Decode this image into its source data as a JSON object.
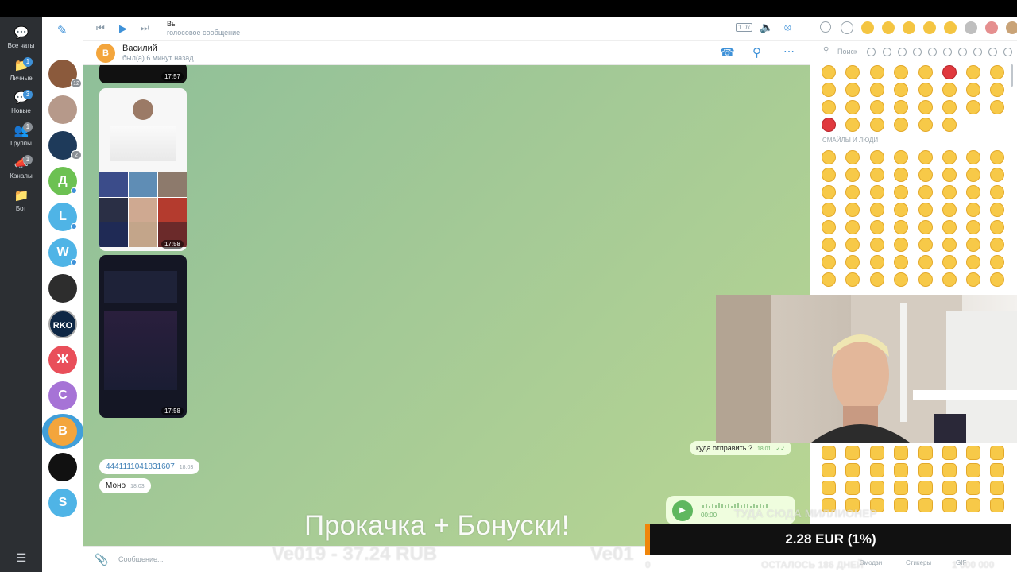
{
  "nav": {
    "items": [
      {
        "label": "Все чаты",
        "badge": "",
        "icon": "chat-icon"
      },
      {
        "label": "Личные",
        "badge": "1",
        "icon": "folder-icon"
      },
      {
        "label": "Новые",
        "badge": "3",
        "icon": "chat-icon"
      },
      {
        "label": "Группы",
        "badge": "1",
        "icon": "group-icon"
      },
      {
        "label": "Каналы",
        "badge": "1",
        "icon": "megaphone-icon"
      },
      {
        "label": "Бот",
        "badge": "",
        "icon": "folder-icon"
      }
    ]
  },
  "chatlist": {
    "avatars": [
      {
        "letter": "",
        "color": "#8b5a3c",
        "badge": "12",
        "online": false
      },
      {
        "letter": "",
        "color": "#b6998a",
        "badge": "",
        "online": false
      },
      {
        "letter": "",
        "color": "#1e3a5a",
        "badge": "2",
        "online": false
      },
      {
        "letter": "Д",
        "color": "#6cc152",
        "badge": "",
        "online": true
      },
      {
        "letter": "L",
        "color": "#4fb4e6",
        "badge": "",
        "online": true
      },
      {
        "letter": "W",
        "color": "#4fb4e6",
        "badge": "",
        "online": true
      },
      {
        "letter": "",
        "color": "#2d2d2d",
        "badge": "",
        "online": false
      },
      {
        "letter": "RKO",
        "color": "#0e2745",
        "badge": "",
        "online": false
      },
      {
        "letter": "Ж",
        "color": "#e94f5a",
        "badge": "",
        "online": false
      },
      {
        "letter": "С",
        "color": "#a673d6",
        "badge": "",
        "online": false
      },
      {
        "letter": "В",
        "color": "#f3a53c",
        "badge": "",
        "online": false
      },
      {
        "letter": "",
        "color": "#111111",
        "badge": "",
        "online": false
      },
      {
        "letter": "S",
        "color": "#4fb4e6",
        "badge": "",
        "online": false
      }
    ]
  },
  "player": {
    "name": "Вы",
    "subtitle": "голосовое сообщение",
    "speed": "1.0x"
  },
  "chat": {
    "name": "Василий",
    "status": "был(а) 6 минут назад",
    "avatar_letter": "В",
    "screenshot_times": [
      "17:57",
      "17:58",
      "17:58"
    ],
    "messages_in": [
      {
        "text": "4441111041831607",
        "time": "18:03"
      },
      {
        "text": "Моно",
        "time": "18:03"
      }
    ],
    "message_out": {
      "text": "куда отправить ?",
      "time": "18:01"
    },
    "voice": {
      "duration": "00:00"
    },
    "composer_placeholder": "Сообщение..."
  },
  "emoji_panel": {
    "search_placeholder": "Поиск",
    "section_title": "СМАЙЛЫ И ЛЮДИ",
    "bottom_tabs": [
      "Эмодзи",
      "Стикеры",
      "GIF"
    ]
  },
  "stream_overlay": {
    "title": "Прокачка + Бонуски!",
    "ghost_left": "Ve019 - 37.24 RUB",
    "ghost_mid": "Ve01",
    "ghost_goal": "ТУДА СЮДА МИЛЛИОНЕР",
    "ghost_days": "ОСТАЛОСЬ 186 ДНЕЙ",
    "ghost_zero": "0",
    "ghost_total": "1 000 000",
    "donation": "2.28 EUR (1%)"
  }
}
